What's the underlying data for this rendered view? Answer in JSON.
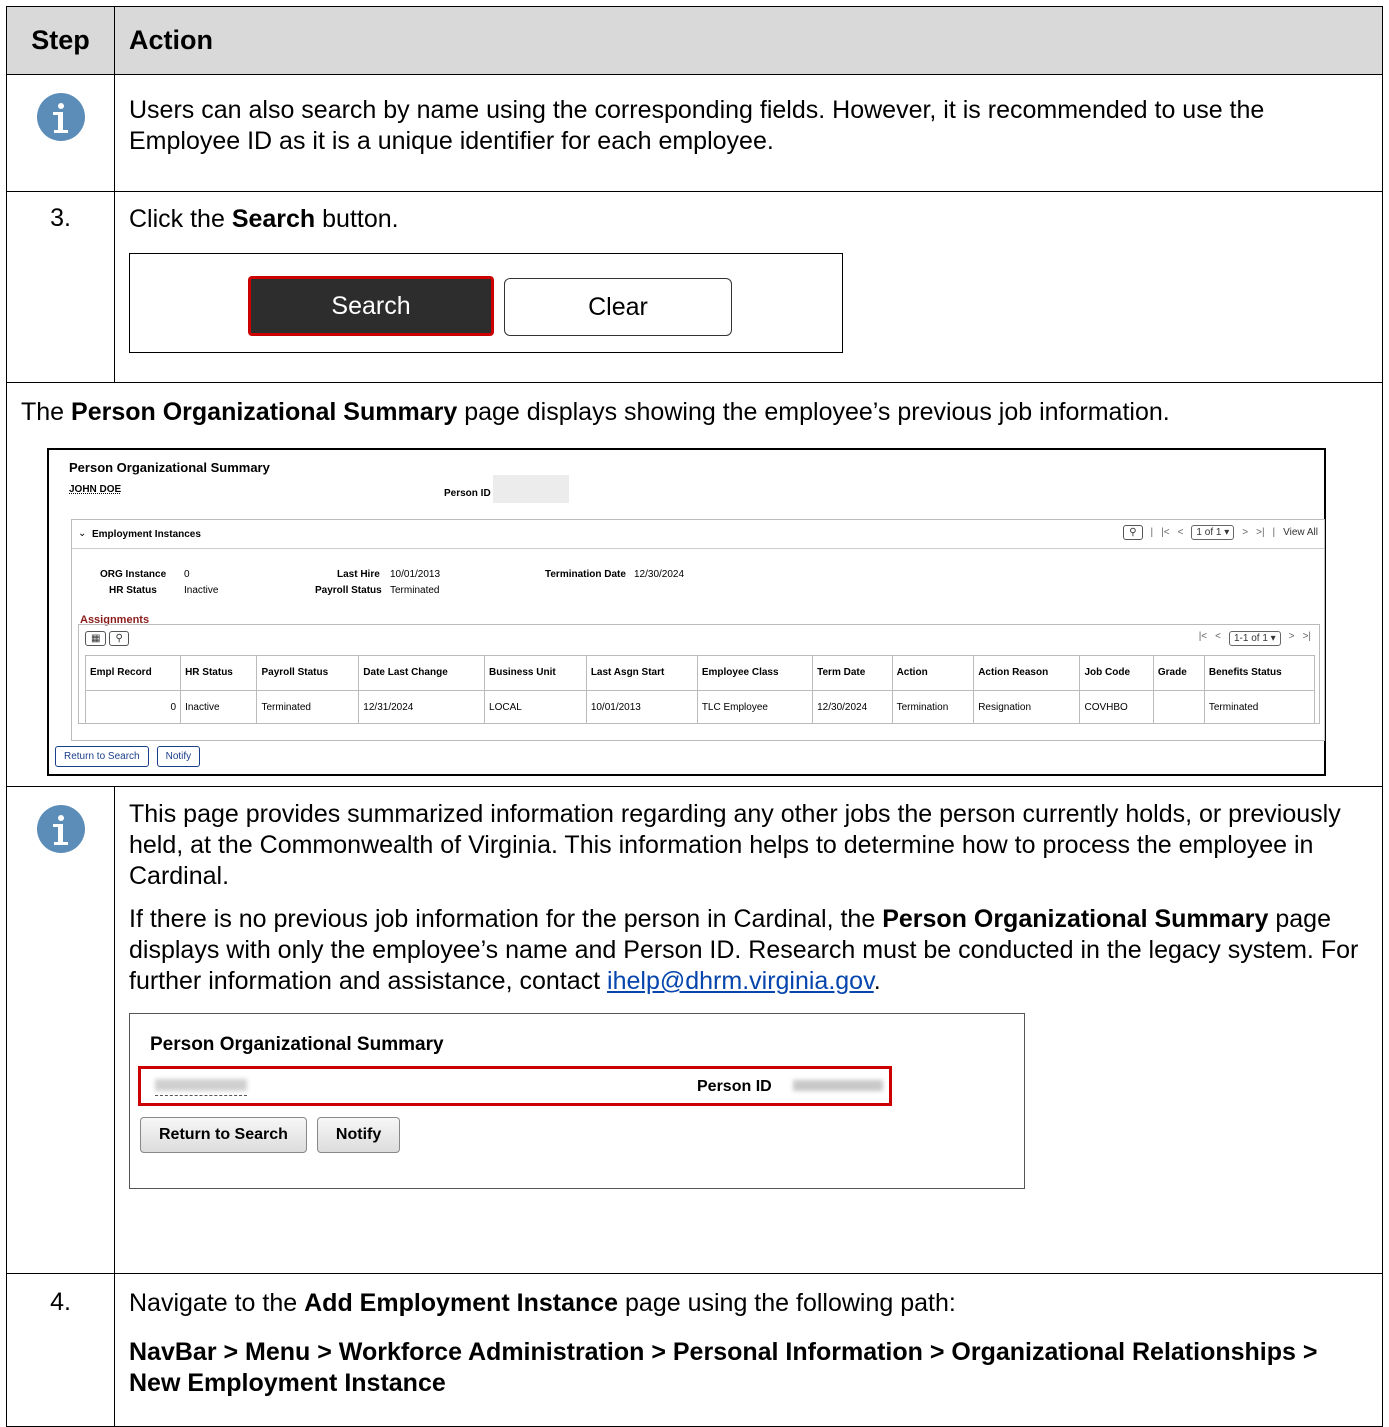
{
  "header": {
    "step": "Step",
    "action": "Action"
  },
  "row_info1": {
    "text": "Users can also search by name using the corresponding fields. However, it is recommended to use the Employee ID as it is a unique identifier for each employee."
  },
  "row_step3": {
    "num": "3.",
    "pre": "Click the ",
    "bold": "Search",
    "post": " button.",
    "search_btn": "Search",
    "clear_btn": "Clear"
  },
  "row_full": {
    "pre": "The ",
    "bold": "Person Organizational Summary",
    "post": " page displays showing the employee’s previous job information."
  },
  "shot2": {
    "title": "Person Organizational Summary",
    "name": "JOHN DOE",
    "person_id_label": "Person ID",
    "panel_title": "Employment Instances",
    "nav": {
      "pager": "1 of 1",
      "sep": "|",
      "view_all": "View All"
    },
    "org_instance_label": "ORG Instance",
    "org_instance": "0",
    "hr_status_label": "HR Status",
    "hr_status": "Inactive",
    "last_hire_label": "Last Hire",
    "last_hire": "10/01/2013",
    "payroll_status_label": "Payroll Status",
    "payroll_status": "Terminated",
    "term_date_label": "Termination Date",
    "term_date": "12/30/2024",
    "assignments_title": "Assignments",
    "grid_pager": "1-1 of 1",
    "columns": [
      "Empl Record",
      "HR Status",
      "Payroll Status",
      "Date Last Change",
      "Business Unit",
      "Last Asgn Start",
      "Employee Class",
      "Term Date",
      "Action",
      "Action Reason",
      "Job Code",
      "Grade",
      "Benefits Status"
    ],
    "row": [
      "0",
      "Inactive",
      "Terminated",
      "12/31/2024",
      "LOCAL",
      "10/01/2013",
      "TLC Employee",
      "12/30/2024",
      "Termination",
      "Resignation",
      "COVHBO",
      "",
      "Terminated"
    ],
    "return_btn": "Return to Search",
    "notify_btn": "Notify"
  },
  "row_info2": {
    "para1": "This page provides summarized information regarding any other jobs the person currently holds, or previously held, at the Commonwealth of Virginia. This information helps to determine how to process the employee in Cardinal.",
    "para2_pre": "If there is no previous job information for the person in Cardinal, the ",
    "para2_bold": "Person Organizational Summary",
    "para2_post": " page displays with only the employee’s name and Person ID. Research must be conducted in the legacy system. For further information and assistance, contact ",
    "email": "ihelp@dhrm.virginia.gov",
    "period": "."
  },
  "shot3": {
    "title": "Person Organizational Summary",
    "person_id_label": "Person ID",
    "return_btn": "Return to Search",
    "notify_btn": "Notify"
  },
  "row_step4": {
    "num": "4.",
    "pre": "Navigate to the ",
    "bold": "Add Employment Instance",
    "post": " page using the following path:",
    "path": "NavBar > Menu > Workforce Administration > Personal Information > Organizational Relationships > New Employment Instance"
  },
  "colors": {
    "icon": "#5b8db8",
    "highlight": "#cc0000",
    "header_bg": "#d9d9d9",
    "link": "#0645ad"
  }
}
